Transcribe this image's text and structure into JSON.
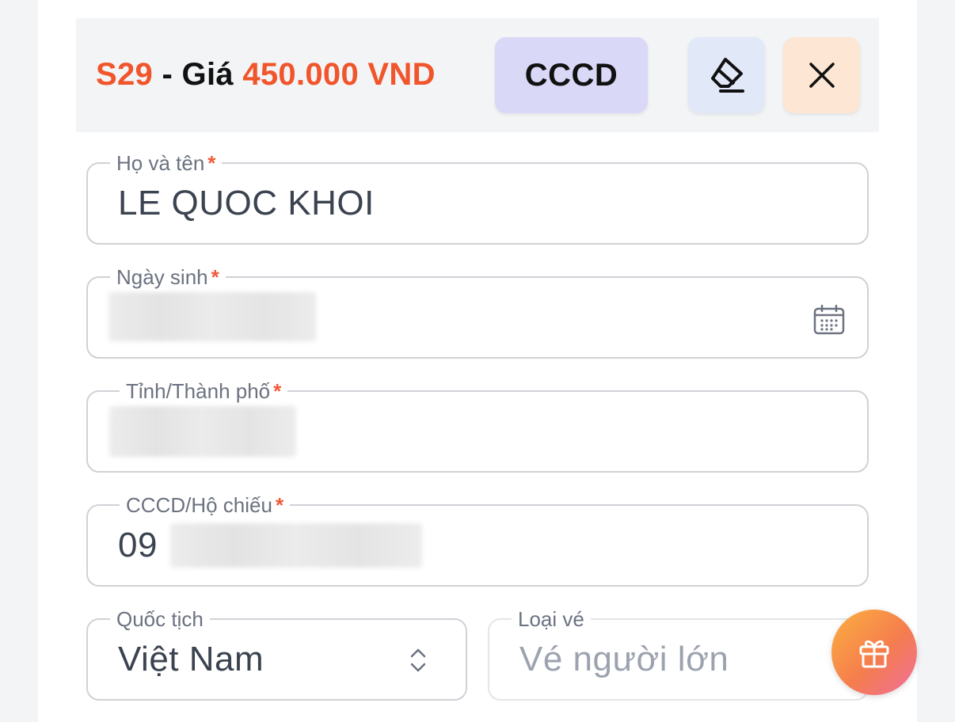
{
  "ticket": {
    "seat": "S29",
    "separator": " - Giá ",
    "price": "450.000 VND"
  },
  "toolbar": {
    "cccd_label": "CCCD"
  },
  "form": {
    "full_name": {
      "label": "Họ và tên",
      "required": "*",
      "value": "LE QUOC KHOI"
    },
    "dob": {
      "label": "Ngày sinh",
      "required": "*",
      "value": ""
    },
    "province": {
      "label": "Tỉnh/Thành phố",
      "required": "*",
      "value": ""
    },
    "id_number": {
      "label": "CCCD/Hộ chiếu",
      "required": "*",
      "value_visible_prefix": "09"
    },
    "nationality": {
      "label": "Quốc tịch",
      "value": "Việt Nam"
    },
    "ticket_type": {
      "label": "Loại vé",
      "value": "Vé người lớn"
    }
  },
  "icons": {
    "eraser": "eraser-icon",
    "close": "close-icon",
    "calendar": "calendar-icon",
    "chevron": "chevron-up-down-icon",
    "gift": "gift-icon"
  },
  "colors": {
    "accent": "#f0552b",
    "required": "#ef5b3a",
    "cccd_button_bg": "#d9d8f7",
    "eraser_button_bg": "#e1e8f8",
    "close_button_bg": "#fde6d3"
  }
}
